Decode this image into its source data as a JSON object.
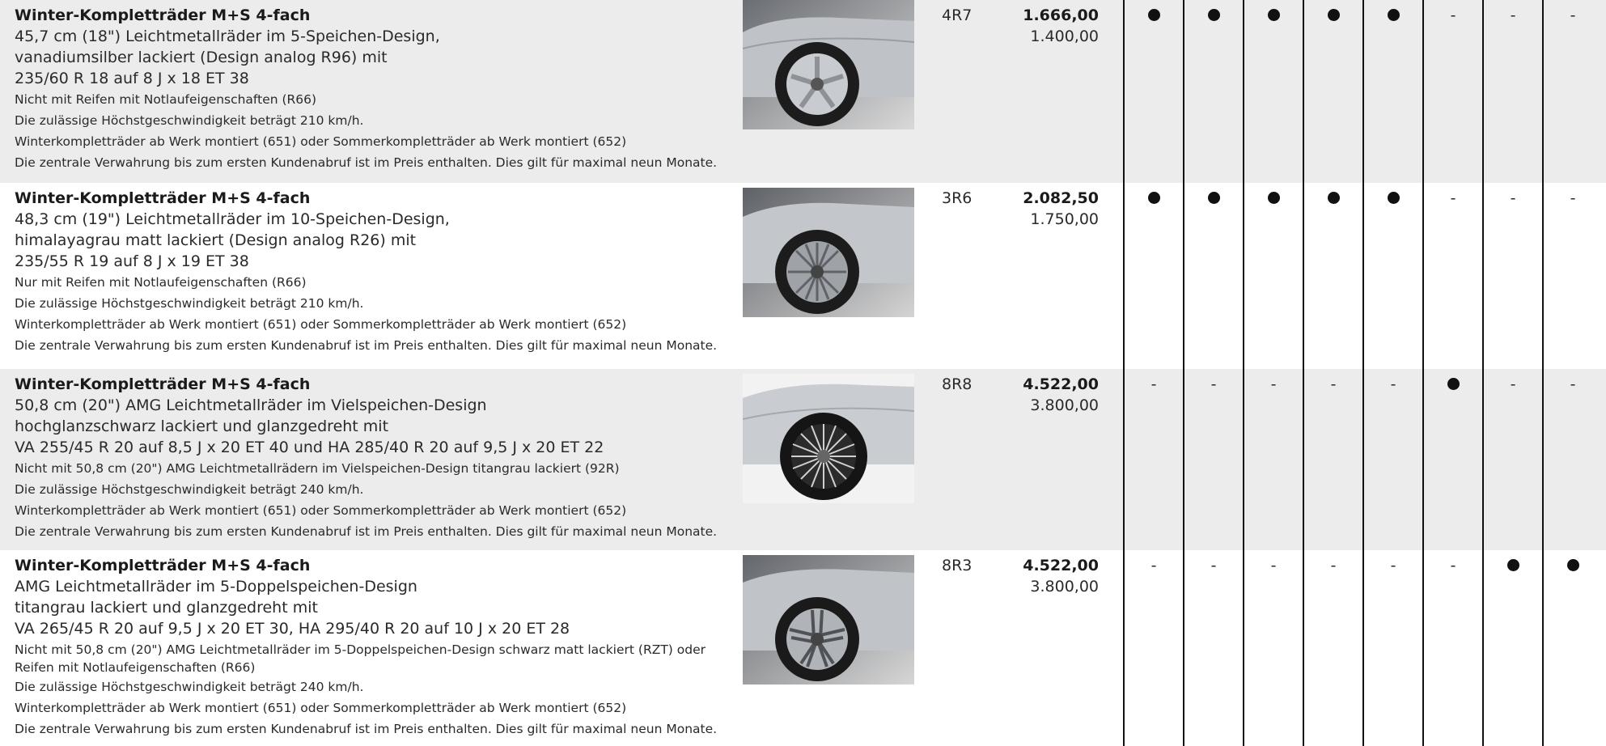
{
  "availability_marks": {
    "dot": "●",
    "dash": "-"
  },
  "rows": [
    {
      "title": "Winter-Kompletträder M+S 4-fach",
      "lines": [
        "45,7 cm (18\") Leichtmetallräder im 5-Speichen-Design,",
        "vanadiumsilber lackiert (Design analog R96) mit",
        "235/60 R 18 auf 8 J x 18 ET 38"
      ],
      "notes": [
        "Nicht mit Reifen mit Notlaufeigenschaften (R66)",
        "Die zulässige Höchstgeschwindigkeit beträgt 210 km/h.",
        "Winterkompletträder ab Werk montiert (651) oder Sommerkompletträder ab Werk montiert (652)",
        "Die zentrale Verwahrung bis zum ersten Kundenabruf ist im Preis enthalten. Dies gilt für maximal neun Monate."
      ],
      "code": "4R7",
      "price_gross": "1.666,00",
      "price_net": "1.400,00",
      "availability": [
        "dot",
        "dot",
        "dot",
        "dot",
        "dot",
        "dash",
        "dash",
        "dash"
      ],
      "image": "winter-wheel-5-spoke-silver"
    },
    {
      "title": "Winter-Kompletträder M+S 4-fach",
      "lines": [
        "48,3 cm (19\") Leichtmetallräder im 10-Speichen-Design,",
        "himalayagrau matt lackiert (Design analog R26) mit",
        "235/55 R 19 auf 8 J x 19 ET 38"
      ],
      "notes": [
        "Nur mit Reifen mit Notlaufeigenschaften (R66)",
        "Die zulässige Höchstgeschwindigkeit beträgt 210 km/h.",
        "Winterkompletträder ab Werk montiert (651) oder Sommerkompletträder ab Werk montiert (652)",
        "Die zentrale Verwahrung bis zum ersten Kundenabruf ist im Preis enthalten. Dies gilt für maximal neun Monate."
      ],
      "code": "3R6",
      "price_gross": "2.082,50",
      "price_net": "1.750,00",
      "availability": [
        "dot",
        "dot",
        "dot",
        "dot",
        "dot",
        "dash",
        "dash",
        "dash"
      ],
      "image": "winter-wheel-10-spoke-grey"
    },
    {
      "title": "Winter-Kompletträder M+S 4-fach",
      "lines": [
        "50,8 cm (20\") AMG Leichtmetallräder im Vielspeichen-Design",
        "hochglanzschwarz lackiert und glanzgedreht mit",
        "VA 255/45 R 20 auf 8,5 J x 20 ET 40 und HA 285/40 R 20 auf 9,5 J x 20 ET 22"
      ],
      "notes": [
        "Nicht mit 50,8 cm (20\") AMG Leichtmetallrädern im Vielspeichen-Design titangrau lackiert (92R)",
        "Die zulässige Höchstgeschwindigkeit beträgt 240 km/h.",
        "Winterkompletträder ab Werk montiert (651) oder Sommerkompletträder ab Werk montiert (652)",
        "Die zentrale Verwahrung bis zum ersten Kundenabruf ist im Preis enthalten. Dies gilt für maximal neun Monate."
      ],
      "code": "8R8",
      "price_gross": "4.522,00",
      "price_net": "3.800,00",
      "availability": [
        "dash",
        "dash",
        "dash",
        "dash",
        "dash",
        "dot",
        "dash",
        "dash"
      ],
      "image": "winter-wheel-amg-multi-spoke-black"
    },
    {
      "title": "Winter-Kompletträder M+S 4-fach",
      "lines": [
        "AMG Leichtmetallräder im 5-Doppelspeichen-Design",
        "titangrau lackiert und glanzgedreht mit",
        "VA 265/45 R 20 auf 9,5 J x 20 ET 30, HA 295/40 R 20 auf 10 J x 20 ET 28"
      ],
      "notes": [
        "Nicht mit 50,8 cm (20\") AMG Leichtmetallräder im 5-Doppelspeichen-Design schwarz matt lackiert (RZT) oder Reifen mit Notlaufeigenschaften (R66)",
        "Die zulässige Höchstgeschwindigkeit beträgt 240 km/h.",
        "Winterkompletträder ab Werk montiert (651) oder Sommerkompletträder ab Werk montiert (652)",
        "Die zentrale Verwahrung bis zum ersten Kundenabruf ist im Preis enthalten. Dies gilt für maximal neun Monate."
      ],
      "code": "8R3",
      "price_gross": "4.522,00",
      "price_net": "3.800,00",
      "availability": [
        "dash",
        "dash",
        "dash",
        "dash",
        "dash",
        "dash",
        "dot",
        "dot"
      ],
      "image": "winter-wheel-amg-5-twin-spoke-titanium"
    }
  ]
}
